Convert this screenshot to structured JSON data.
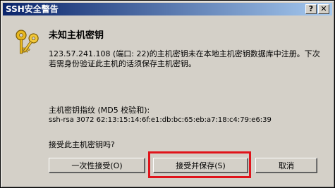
{
  "window": {
    "title": "SSH安全警告",
    "help_glyph": "?",
    "close_glyph": "✕"
  },
  "dialog": {
    "heading": "未知主机密钥",
    "message": "123.57.241.108 (端口: 22)的主机密钥未在本地主机密钥数据库中注册。下次若需身份验证此主机的话须保存主机密钥。",
    "fingerprint_label": "主机密钥指纹 (MD5 校验和):",
    "fingerprint_value": "ssh-rsa 3072 62:13:15:14:6f:e1:db:bc:65:eb:a7:18:c4:79:e6:39",
    "question": "接受此主机密钥吗?"
  },
  "buttons": {
    "accept_once": "一次性接受(O)",
    "accept_save": "接受并保存(S)",
    "cancel": "取消"
  },
  "colors": {
    "highlight": "#e0141b",
    "title_gradient_start": "#0a246a",
    "title_gradient_end": "#a6caf0"
  },
  "icons": {
    "dialog_icon": "keys-icon"
  }
}
